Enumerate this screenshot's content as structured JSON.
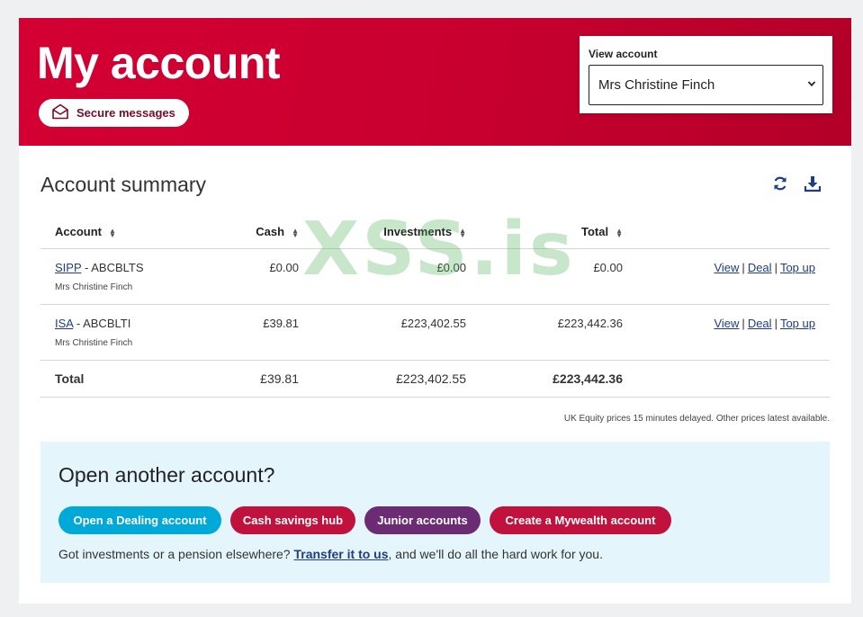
{
  "header": {
    "title": "My account",
    "secure_messages_label": "Secure messages",
    "view_account_label": "View account",
    "view_account_value": "Mrs Christine Finch"
  },
  "summary": {
    "title": "Account summary",
    "columns": [
      "Account",
      "Cash",
      "Investments",
      "Total"
    ],
    "rows": [
      {
        "type": "SIPP",
        "code": " - ABCBLTS",
        "holder": "Mrs Christine Finch",
        "cash": "£0.00",
        "investments": "£0.00",
        "total": "£0.00"
      },
      {
        "type": "ISA",
        "code": " - ABCBLTI",
        "holder": "Mrs Christine Finch",
        "cash": "£39.81",
        "investments": "£223,402.55",
        "total": "£223,442.36"
      }
    ],
    "actions": {
      "view": "View",
      "deal": "Deal",
      "top_up": "Top up",
      "separator": "|"
    },
    "total_row": {
      "label": "Total",
      "cash": "£39.81",
      "investments": "£223,402.55",
      "total": "£223,442.36"
    },
    "disclaimer": "UK Equity prices 15 minutes delayed. Other prices latest available."
  },
  "open_account": {
    "title": "Open another account?",
    "buttons": [
      {
        "label": "Open a Dealing account",
        "color": "#00a9d8"
      },
      {
        "label": "Cash savings hub",
        "color": "#c0123c"
      },
      {
        "label": "Junior accounts",
        "color": "#6b2c73"
      },
      {
        "label": "Create a Mywealth account",
        "color": "#c0123c"
      }
    ],
    "transfer_prefix": "Got investments or a pension elsewhere? ",
    "transfer_link": "Transfer it to us",
    "transfer_suffix": ", and we'll do all the hard work for you."
  },
  "watermark": "XSS.is",
  "icons": {
    "messages": "envelope-icon",
    "refresh": "refresh-icon",
    "download": "download-icon",
    "select": "chevron-down-icon",
    "sort": "sort-icon"
  },
  "colors": {
    "brand_red": "#d40033",
    "link_blue": "#1f3c88",
    "panel_bg": "#e4f6fb"
  }
}
